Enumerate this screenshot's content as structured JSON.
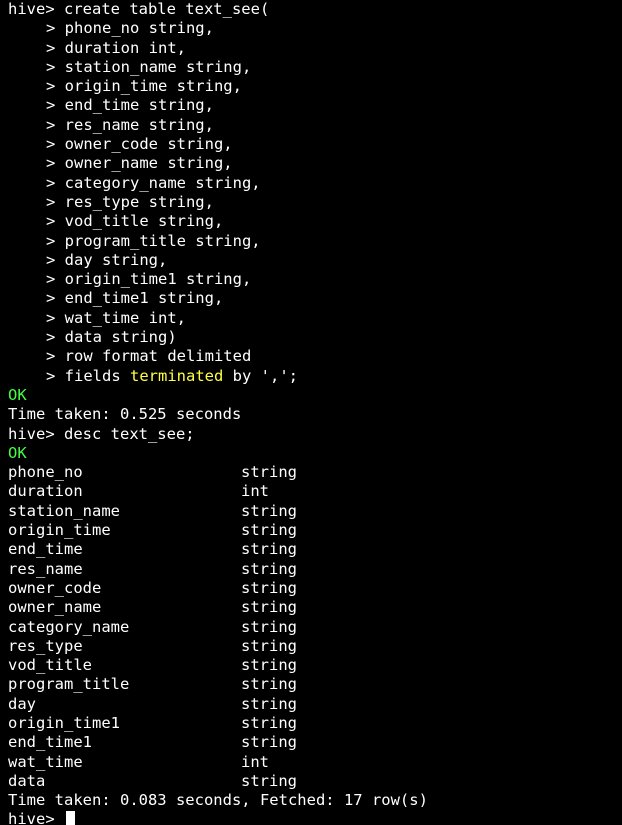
{
  "colors": {
    "background": "#000000",
    "text": "#ffffff",
    "ok": "#44ff44",
    "keyword": "#ffff44"
  },
  "create_command": {
    "first_line": "hive> create table text_see(",
    "continuation_lines": [
      "> phone_no string,",
      "> duration int,",
      "> station_name string,",
      "> origin_time string,",
      "> end_time string,",
      "> res_name string,",
      "> owner_code string,",
      "> owner_name string,",
      "> category_name string,",
      "> res_type string,",
      "> vod_title string,",
      "> program_title string,",
      "> day string,",
      "> origin_time1 string,",
      "> end_time1 string,",
      "> wat_time int,",
      "> data string)",
      "> row format delimited"
    ],
    "last_line_prefix": "> fields ",
    "last_line_keyword": "terminated",
    "last_line_suffix": " by ',';"
  },
  "result1": {
    "ok": "OK",
    "time": "Time taken: 0.525 seconds"
  },
  "desc_command": "hive> desc text_see;",
  "result2_ok": "OK",
  "desc_rows": [
    {
      "name": "phone_no",
      "type": "string"
    },
    {
      "name": "duration",
      "type": "int"
    },
    {
      "name": "station_name",
      "type": "string"
    },
    {
      "name": "origin_time",
      "type": "string"
    },
    {
      "name": "end_time",
      "type": "string"
    },
    {
      "name": "res_name",
      "type": "string"
    },
    {
      "name": "owner_code",
      "type": "string"
    },
    {
      "name": "owner_name",
      "type": "string"
    },
    {
      "name": "category_name",
      "type": "string"
    },
    {
      "name": "res_type",
      "type": "string"
    },
    {
      "name": "vod_title",
      "type": "string"
    },
    {
      "name": "program_title",
      "type": "string"
    },
    {
      "name": "day",
      "type": "string"
    },
    {
      "name": "origin_time1",
      "type": "string"
    },
    {
      "name": "end_time1",
      "type": "string"
    },
    {
      "name": "wat_time",
      "type": "int"
    },
    {
      "name": "data",
      "type": "string"
    }
  ],
  "result2_time": "Time taken: 0.083 seconds, Fetched: 17 row(s)",
  "prompt": "hive> "
}
